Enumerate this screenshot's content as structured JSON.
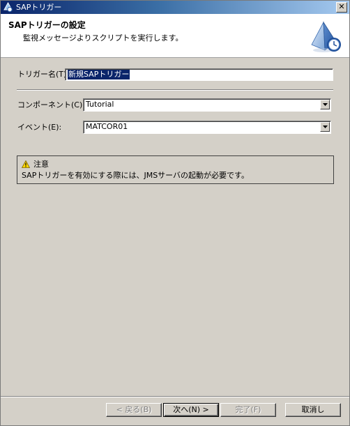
{
  "window": {
    "title": "SAPトリガー",
    "close_glyph": "✕",
    "app_icon": "sap-trigger-app-icon"
  },
  "banner": {
    "title": "SAPトリガーの設定",
    "description": "監視メッセージよりスクリプトを実行します。",
    "graphic": "wizard-pyramid-clock-icon"
  },
  "form": {
    "trigger_name_label": "トリガー名(T):",
    "trigger_name_value": "新規SAPトリガー",
    "component_label": "コンポーネント(C):",
    "component_value": "Tutorial",
    "event_label": "イベント(E):",
    "event_value": "MATCOR01"
  },
  "note": {
    "icon": "warning-icon",
    "title": "注意",
    "text": "SAPトリガーを有効にする際には、JMSサーバの起動が必要です。"
  },
  "buttons": {
    "back": "< 戻る(B)",
    "next": "次へ(N) >",
    "finish": "完了(F)",
    "cancel": "取消し"
  },
  "colors": {
    "titlebar_start": "#0a246a",
    "titlebar_end": "#a6caf0",
    "dialog_bg": "#d4d0c8",
    "selection": "#0a246a"
  }
}
